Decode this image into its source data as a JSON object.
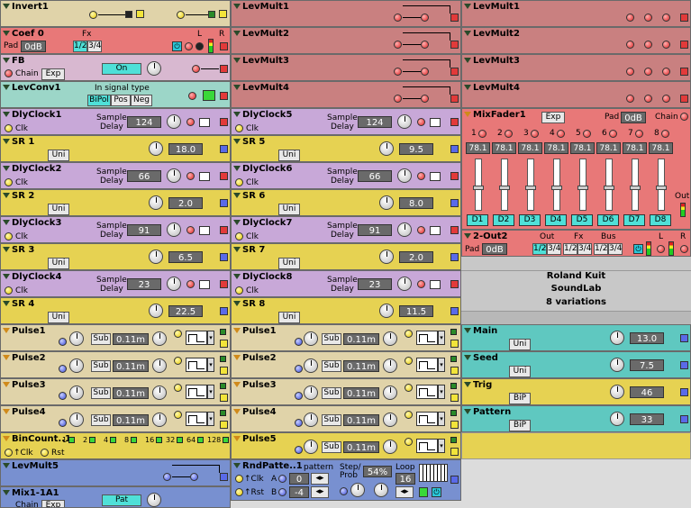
{
  "modules": {
    "invert1": "Invert1",
    "coef0": {
      "title": "Coef 0",
      "pad_label": "Pad",
      "pad_value": "0dB",
      "fx": "Fx",
      "b12": "1/2",
      "b34": "3/4",
      "l": "L",
      "r": "R"
    },
    "fb": {
      "title": "FB",
      "chain": "Chain",
      "exp": "Exp",
      "on": "On"
    },
    "levconv1": {
      "title": "LevConv1",
      "input_label": "In signal type",
      "bipol": "BiPol",
      "pos": "Pos",
      "neg": "Neg"
    },
    "levmult_mid": [
      "LevMult1",
      "LevMult2",
      "LevMult3",
      "LevMult4"
    ],
    "levmult_right": [
      "LevMult1",
      "LevMult2",
      "LevMult3",
      "LevMult4"
    ],
    "dlyclocks_left": [
      {
        "title": "DlyClock1",
        "value": "124"
      },
      {
        "title": "DlyClock2",
        "value": "66"
      },
      {
        "title": "DlyClock3",
        "value": "91"
      },
      {
        "title": "DlyClock4",
        "value": "23"
      }
    ],
    "dlyclocks_mid": [
      {
        "title": "DlyClock5",
        "value": "124"
      },
      {
        "title": "DlyClock6",
        "value": "66"
      },
      {
        "title": "DlyClock7",
        "value": "91"
      },
      {
        "title": "DlyClock8",
        "value": "23"
      }
    ],
    "sample_delay_1": "Sample",
    "sample_delay_2": "Delay",
    "clk": "Clk",
    "uni": "Uni",
    "sr_left": [
      {
        "title": "SR 1",
        "value": "18.0"
      },
      {
        "title": "SR 2",
        "value": "2.0"
      },
      {
        "title": "SR 3",
        "value": "6.5"
      },
      {
        "title": "SR 4",
        "value": "22.5"
      }
    ],
    "sr_mid": [
      {
        "title": "SR 5",
        "value": "9.5"
      },
      {
        "title": "SR 6",
        "value": "8.0"
      },
      {
        "title": "SR 7",
        "value": "2.0"
      },
      {
        "title": "SR 8",
        "value": "11.5"
      }
    ],
    "mixfader": {
      "title": "MixFader1",
      "exp": "Exp",
      "pad_label": "Pad",
      "pad_value": "0dB",
      "chain": "Chain",
      "out": "Out",
      "channels": [
        "1",
        "2",
        "3",
        "4",
        "5",
        "6",
        "7",
        "8"
      ],
      "values": [
        "78.1",
        "78.1",
        "78.1",
        "78.1",
        "78.1",
        "78.1",
        "78.1",
        "78.1"
      ],
      "buttons": [
        "D1",
        "D2",
        "D3",
        "D4",
        "D5",
        "D6",
        "D7",
        "D8"
      ],
      "levels": [
        0.45,
        0.45,
        0.45,
        0.45,
        0.45,
        0.45,
        0.45,
        0.45
      ]
    },
    "out2": {
      "title": "2-Out2",
      "pad_label": "Pad",
      "pad_value": "0dB",
      "out": "Out",
      "fx": "Fx",
      "bus": "Bus",
      "b12a": "1/2",
      "b34a": "3/4",
      "b12b": "1/2",
      "b34b": "3/4",
      "b12c": "1/2",
      "b34c": "3/4",
      "l": "L",
      "r": "R"
    },
    "captions": [
      "Roland Kuit",
      "SoundLab",
      "8 variations"
    ],
    "pulses_left": [
      "Pulse1",
      "Pulse2",
      "Pulse3",
      "Pulse4"
    ],
    "pulses_mid": [
      "Pulse1",
      "Pulse2",
      "Pulse3",
      "Pulse4",
      "Pulse5"
    ],
    "pulse_sub": "Sub",
    "pulse_value": "0.11m",
    "right_consts": [
      {
        "title": "Main",
        "mode": "Uni",
        "value": "13.0"
      },
      {
        "title": "Seed",
        "mode": "Uni",
        "value": "7.5"
      },
      {
        "title": "Trig",
        "mode": "BiP",
        "value": "46"
      },
      {
        "title": "Pattern",
        "mode": "BiP",
        "value": "33"
      }
    ],
    "bincount": {
      "title": "BinCount..1",
      "bits": [
        "1",
        "2",
        "4",
        "8",
        "16",
        "32",
        "64",
        "128"
      ],
      "clk": "↑Clk",
      "rst": "Rst"
    },
    "levmult5": "LevMult5",
    "rndpatt": {
      "title": "RndPatte..1",
      "pattern": "pattern",
      "step": "Step/",
      "prob": "Prob",
      "pct": "54%",
      "loop": "Loop",
      "loop_val": "16",
      "a": "A",
      "b": "B",
      "a_val": "0",
      "b_val": "-4",
      "clk": "↑Clk",
      "rst": "↑Rst"
    },
    "mix1": {
      "title": "Mix1-1A1",
      "chain": "Chain",
      "exp": "Exp",
      "pat": "Pat"
    }
  }
}
